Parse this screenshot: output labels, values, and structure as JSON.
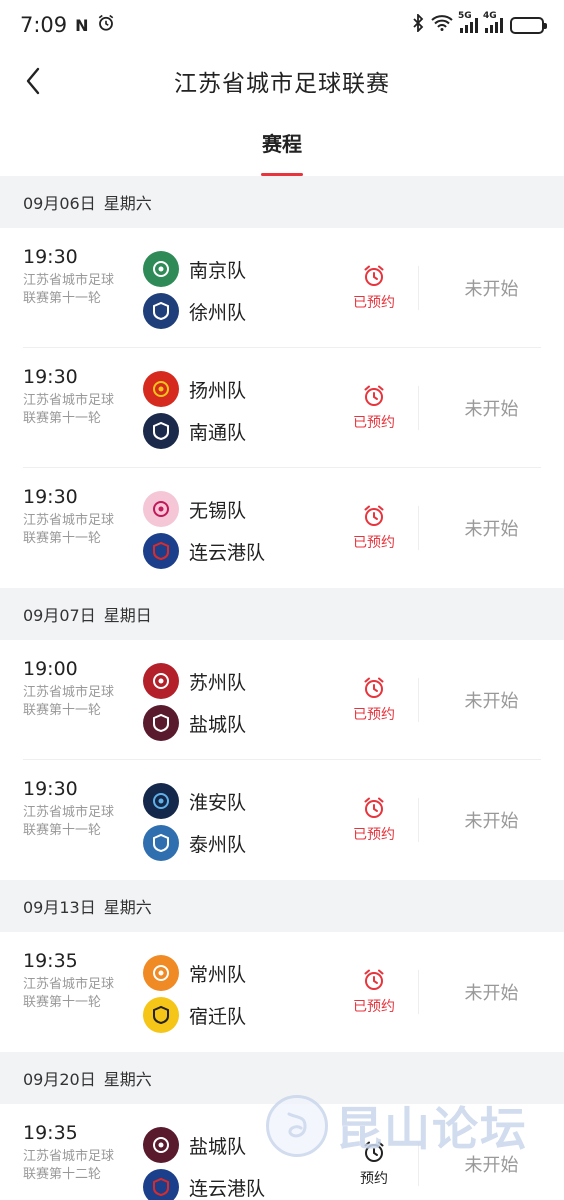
{
  "status_bar": {
    "time": "7:09",
    "left_icons": [
      "nfc-icon",
      "alarm-icon"
    ],
    "right_icons": [
      "bluetooth-icon",
      "wifi-icon",
      "signal-5g-icon",
      "signal-4g-icon",
      "battery-icon"
    ],
    "sig1_tag": "5G",
    "sig2_tag": "4G",
    "battery_level": 0.55
  },
  "header": {
    "title": "江苏省城市足球联赛"
  },
  "tabs": [
    {
      "label": "赛程"
    }
  ],
  "colors": {
    "accent": "#e8343c",
    "muted": "#999999",
    "section_bg": "#f2f3f5"
  },
  "groups": [
    {
      "date": "09月06日",
      "weekday": "星期六",
      "matches": [
        {
          "time": "19:30",
          "round": "江苏省城市足球联赛第十一轮",
          "home": "南京队",
          "away": "徐州队",
          "remind": "已预约",
          "status": "未开始"
        },
        {
          "time": "19:30",
          "round": "江苏省城市足球联赛第十一轮",
          "home": "扬州队",
          "away": "南通队",
          "remind": "已预约",
          "status": "未开始"
        },
        {
          "time": "19:30",
          "round": "江苏省城市足球联赛第十一轮",
          "home": "无锡队",
          "away": "连云港队",
          "remind": "已预约",
          "status": "未开始"
        }
      ]
    },
    {
      "date": "09月07日",
      "weekday": "星期日",
      "matches": [
        {
          "time": "19:00",
          "round": "江苏省城市足球联赛第十一轮",
          "home": "苏州队",
          "away": "盐城队",
          "remind": "已预约",
          "status": "未开始"
        },
        {
          "time": "19:30",
          "round": "江苏省城市足球联赛第十一轮",
          "home": "淮安队",
          "away": "泰州队",
          "remind": "已预约",
          "status": "未开始"
        }
      ]
    },
    {
      "date": "09月13日",
      "weekday": "星期六",
      "matches": [
        {
          "time": "19:35",
          "round": "江苏省城市足球联赛第十一轮",
          "home": "常州队",
          "away": "宿迁队",
          "remind": "已预约",
          "status": "未开始"
        }
      ]
    },
    {
      "date": "09月20日",
      "weekday": "星期六",
      "matches": [
        {
          "time": "19:35",
          "round": "江苏省城市足球联赛第十二轮",
          "home": "盐城队",
          "away": "连云港队",
          "remind": "预约",
          "status": "未开始"
        }
      ]
    }
  ],
  "watermark": {
    "text": "昆山论坛"
  }
}
